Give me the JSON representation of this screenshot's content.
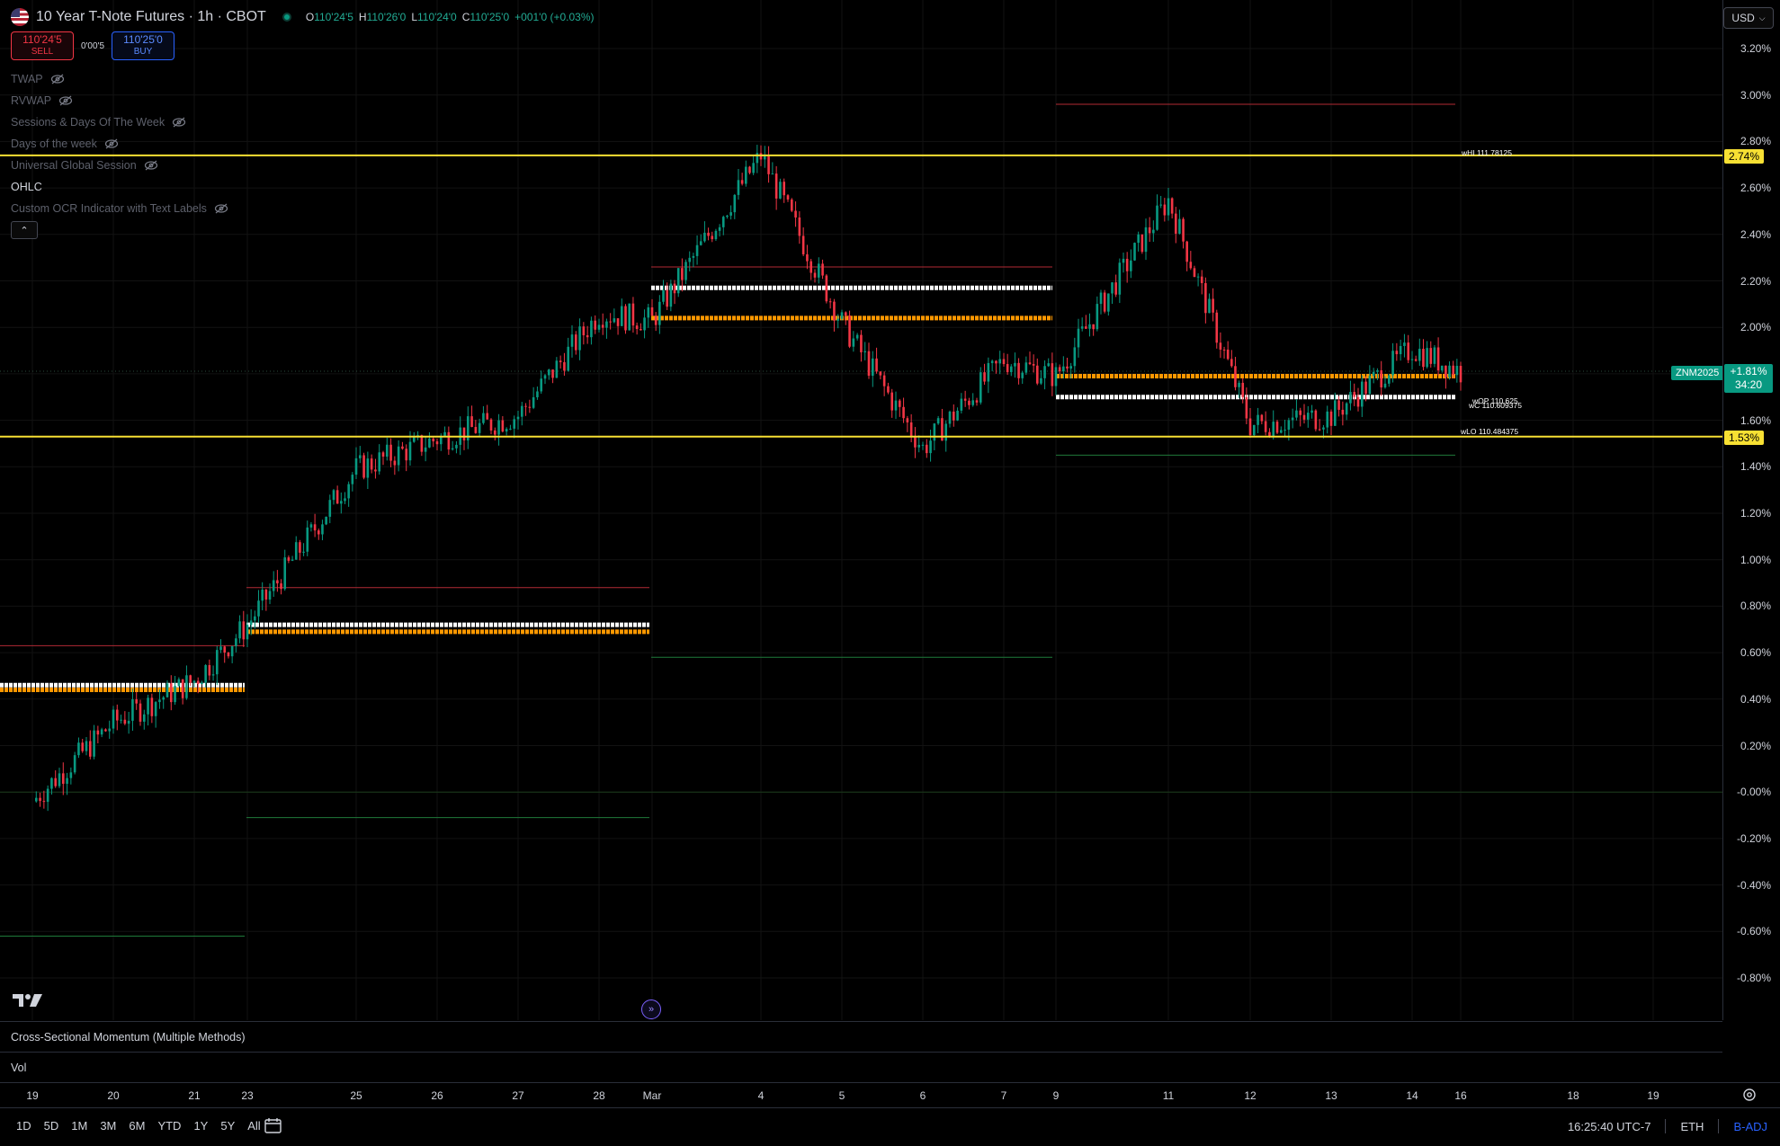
{
  "header": {
    "symbol_title": "10 Year T-Note Futures · 1h · CBOT",
    "ohlc": [
      {
        "k": "O",
        "v": "110'24'5"
      },
      {
        "k": "H",
        "v": "110'26'0"
      },
      {
        "k": "L",
        "v": "110'24'0"
      },
      {
        "k": "C",
        "v": "110'25'0"
      },
      {
        "k": "",
        "v": "+001'0 (+0.03%)"
      }
    ]
  },
  "trade": {
    "sell_price": "110'24'5",
    "sell_label": "SELL",
    "spread": "0'00'5",
    "buy_price": "110'25'0",
    "buy_label": "BUY"
  },
  "indicators": [
    {
      "label": "TWAP",
      "visible": false
    },
    {
      "label": "RVWAP",
      "visible": false
    },
    {
      "label": "Sessions & Days Of The Week",
      "visible": false
    },
    {
      "label": "Days of the week",
      "visible": false
    },
    {
      "label": "Universal Global Session",
      "visible": false
    },
    {
      "label": "OHLC",
      "visible": true
    },
    {
      "label": "Custom OCR Indicator with Text Labels",
      "visible": false
    }
  ],
  "price_scale": {
    "currency": "USD",
    "ticks": [
      "3.20%",
      "3.00%",
      "2.80%",
      "2.60%",
      "2.40%",
      "2.20%",
      "2.00%",
      "1.80%",
      "1.60%",
      "1.40%",
      "1.20%",
      "1.00%",
      "0.80%",
      "0.60%",
      "0.40%",
      "0.20%",
      "-0.00%",
      "-0.20%",
      "-0.40%",
      "-0.60%",
      "-0.80%"
    ],
    "label_high": "2.74%",
    "label_low": "1.53%",
    "label_current_change": "+1.81%",
    "label_current_countdown": "34:20",
    "label_symbol": "ZNM2025"
  },
  "annotations": {
    "week_high": "wHI 111.78125",
    "week_open": "wOP 110.625",
    "week_close": "wC 110.609375",
    "week_low": "wLO 110.484375"
  },
  "panes": {
    "momentum_title": "Cross-Sectional Momentum (Multiple Methods)",
    "vol_title": "Vol"
  },
  "time_axis": [
    "19",
    "20",
    "21",
    "23",
    "25",
    "26",
    "27",
    "28",
    "Mar",
    "4",
    "5",
    "6",
    "7",
    "9",
    "11",
    "12",
    "13",
    "14",
    "16",
    "18",
    "19"
  ],
  "bottom_bar": {
    "ranges": [
      "1D",
      "5D",
      "1M",
      "3M",
      "6M",
      "YTD",
      "1Y",
      "5Y",
      "All"
    ],
    "clock": "16:25:40 UTC-7",
    "session": "ETH",
    "adjust": "B-ADJ"
  },
  "chart_data": {
    "type": "candlestick",
    "y_unit": "% change",
    "ylim": [
      -0.9,
      3.3
    ],
    "candle_colors": {
      "up": "#089981",
      "down": "#f23645"
    },
    "x": [
      "19",
      "20",
      "21",
      "23",
      "25",
      "26",
      "27",
      "28",
      "Mar",
      "4",
      "5",
      "6",
      "7",
      "9",
      "11",
      "12",
      "13",
      "14",
      "16"
    ],
    "close": [
      -0.04,
      0.3,
      0.48,
      0.72,
      1.39,
      1.52,
      1.62,
      2.06,
      2.03,
      2.74,
      2.02,
      1.48,
      1.86,
      1.79,
      2.55,
      1.58,
      1.62,
      1.91,
      1.81
    ],
    "levels": [
      {
        "name": "wHI",
        "value": 2.74,
        "color": "#f7e033"
      },
      {
        "name": "wLO",
        "value": 1.53,
        "color": "#f7e033"
      }
    ],
    "grid": true
  },
  "colors": {
    "background": "#000000",
    "up": "#089981",
    "down": "#f23645",
    "level_yellow": "#f7e033",
    "level_orange": "#ff9800",
    "level_white": "#ffffff",
    "accent_blue": "#2962ff"
  }
}
